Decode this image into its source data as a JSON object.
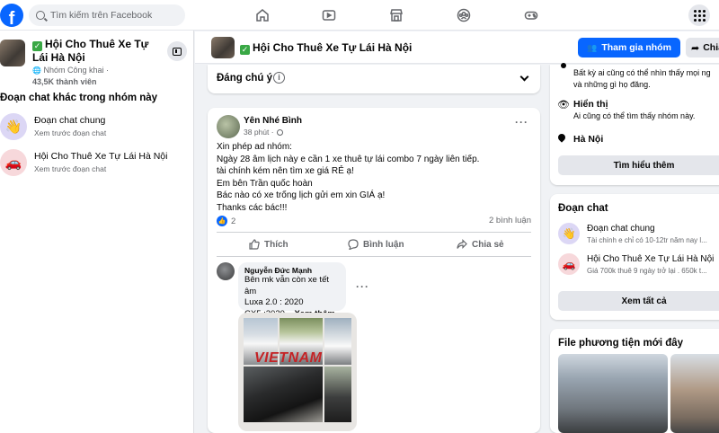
{
  "topbar": {
    "logo_letter": "f",
    "search_placeholder": "Tìm kiếm trên Facebook"
  },
  "left": {
    "group_title": "Hội Cho Thuê Xe Tự Lái Hà Nội",
    "group_type": "Nhóm Công khai ·",
    "member_count": "43,5K thành viên",
    "section_title": "Đoạn chat khác trong nhóm này",
    "chats": [
      {
        "name": "Đoạn chat chung",
        "sub": "Xem trước đoạn chat",
        "avatar": "👋"
      },
      {
        "name": "Hội Cho Thuê Xe Tự Lái Hà Nội",
        "sub": "Xem trước đoạn chat",
        "avatar": "🚗"
      }
    ]
  },
  "group_bar": {
    "title": "Hội Cho Thuê Xe Tự Lái Hà Nội",
    "join_label": "Tham gia nhóm",
    "share_label": "Chia sẻ"
  },
  "featured": {
    "label": "Đáng chú ý",
    "info": "i"
  },
  "post": {
    "author": "Yên Nhé Bình",
    "time": "38 phút ·",
    "lines": [
      "Xin phép ad nhóm:",
      "Ngày 28 âm lịch này e cần 1 xe thuê tự lái combo 7 ngày liên tiếp.",
      "tài chính kém nên tìm xe giá RẺ ạ!",
      "Em bên Trần quốc hoàn",
      "Bác nào có xe trống lịch gửi em xin GIÁ ạ!",
      "Thanks các bác!!!"
    ],
    "like_count": "2",
    "comment_count": "2 bình luận",
    "actions": {
      "like": "Thích",
      "comment": "Bình luận",
      "share": "Chia sẻ"
    },
    "comment": {
      "author": "Nguyễn Đức Mạnh",
      "lines": [
        "Bên mk vẫn còn xe tết âm",
        "Luxa 2.0 : 2020"
      ],
      "last_line": "CX5 :2020...",
      "more": "Xem thêm",
      "watermark": "VIETNAM"
    }
  },
  "right": {
    "privacy_text_1": "Bất kỳ ai cũng có thể nhìn thấy mọi ng",
    "privacy_text_2": "và những gì họ đăng.",
    "visible_title": "Hiển thị",
    "visible_text": "Ai cũng có thể tìm thấy nhóm này.",
    "location": "Hà Nội",
    "learn_more": "Tìm hiểu thêm",
    "chat_title": "Đoạn chat",
    "chats": [
      {
        "name": "Đoạn chat chung",
        "sub": "Tài chính e chỉ có 10-12tr năm nay l...",
        "avatar": "👋"
      },
      {
        "name": "Hội Cho Thuê Xe Tự Lái Hà Nội",
        "sub": "Giá 700k thuê 9 ngày trở lại . 650k t...",
        "avatar": "🚗"
      }
    ],
    "see_all": "Xem tất cả",
    "media_title": "File phương tiện mới đây"
  }
}
